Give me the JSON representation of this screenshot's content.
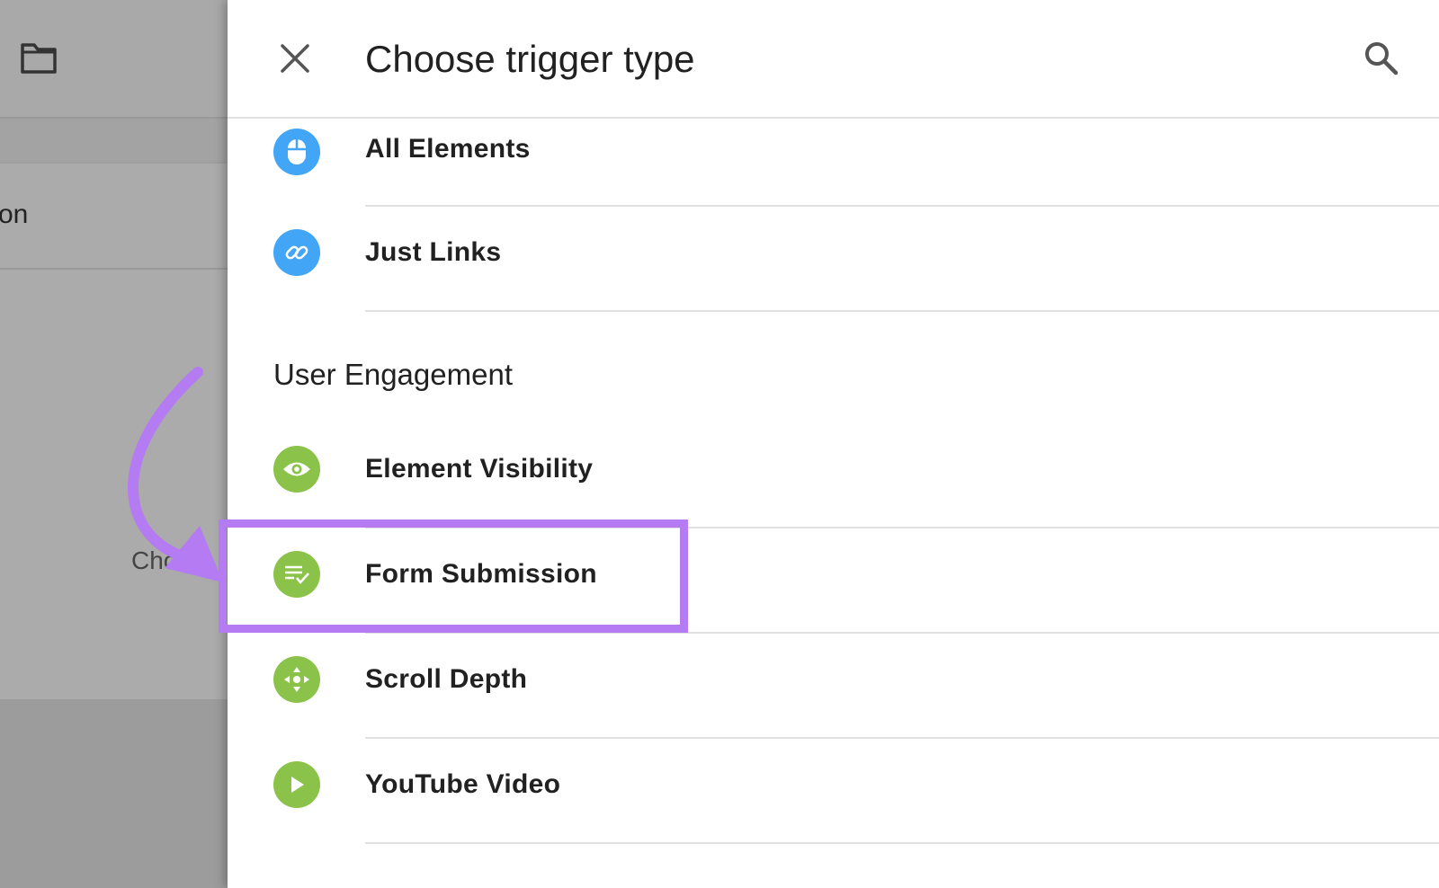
{
  "background": {
    "card_text": "on",
    "choose_text": "Cho"
  },
  "panel": {
    "title": "Choose trigger type",
    "close_icon": "close-icon",
    "search_icon": "search-icon"
  },
  "click_items": [
    {
      "label": "All Elements",
      "icon": "mouse-icon",
      "color": "#42a5f5"
    },
    {
      "label": "Just Links",
      "icon": "link-icon",
      "color": "#42a5f5"
    }
  ],
  "engagement": {
    "section_title": "User Engagement",
    "items": [
      {
        "label": "Element Visibility",
        "icon": "eye-icon",
        "color": "#8bc34a"
      },
      {
        "label": "Form Submission",
        "icon": "form-submit-icon",
        "color": "#8bc34a"
      },
      {
        "label": "Scroll Depth",
        "icon": "scroll-icon",
        "color": "#8bc34a"
      },
      {
        "label": "YouTube Video",
        "icon": "play-icon",
        "color": "#8bc34a"
      }
    ]
  },
  "annotation": {
    "highlight_color": "#b57bf2",
    "highlighted_item": "Form Submission"
  }
}
